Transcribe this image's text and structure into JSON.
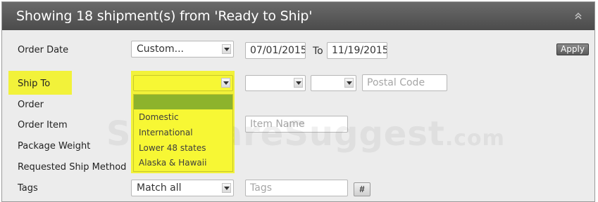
{
  "header": {
    "title": "Showing 18 shipment(s) from 'Ready to Ship'",
    "collapse_icon": "double-chevron-up-icon"
  },
  "labels": {
    "order_date": "Order Date",
    "ship_to": "Ship To",
    "order": "Order",
    "order_item": "Order Item",
    "package_weight": "Package Weight",
    "requested_ship_method": "Requested Ship Method",
    "tags": "Tags"
  },
  "order_date": {
    "preset": "Custom...",
    "from": "07/01/2015",
    "to_label": "To",
    "to": "11/19/2015",
    "apply_label": "Apply"
  },
  "ship_to": {
    "selected": "",
    "options": [
      "",
      "Domestic",
      "International",
      "Lower 48 states",
      "Alaska & Hawaii"
    ],
    "postal_code_placeholder": "Postal Code"
  },
  "order_item": {
    "item_name_placeholder": "Item Name"
  },
  "tags": {
    "match": "Match all",
    "tags_placeholder": "Tags",
    "hash_label": "#"
  },
  "watermark": {
    "text": "SoftwareSuggest",
    "suffix": ".com"
  },
  "colors": {
    "header_bg": "#555555",
    "highlight": "#f2f23a",
    "selected_option": "#8db32c"
  }
}
